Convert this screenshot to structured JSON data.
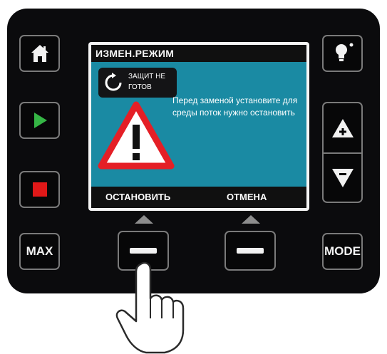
{
  "screen": {
    "title": "ИЗМЕН.РЕЖИМ",
    "status_line1": "ЗАЩИТ НЕ",
    "status_line2": "ГОТОВ",
    "warning_text": "Перед заменой установите для среды поток нужно остановить",
    "softkey_left": "ОСТАНОВИТЬ",
    "softkey_right": "ОТМЕНА"
  },
  "keys": {
    "max_label": "MAX",
    "mode_label": "MODE"
  },
  "colors": {
    "screen_bg": "#1a8aa3",
    "play_green": "#35b545",
    "stop_red": "#e01818",
    "warning_red": "#e41f26"
  },
  "icons": [
    "home-icon",
    "play-icon",
    "stop-icon",
    "lightbulb-icon",
    "plus-arrow-up-icon",
    "minus-arrow-down-icon",
    "warning-icon",
    "hand-pointer-icon"
  ]
}
